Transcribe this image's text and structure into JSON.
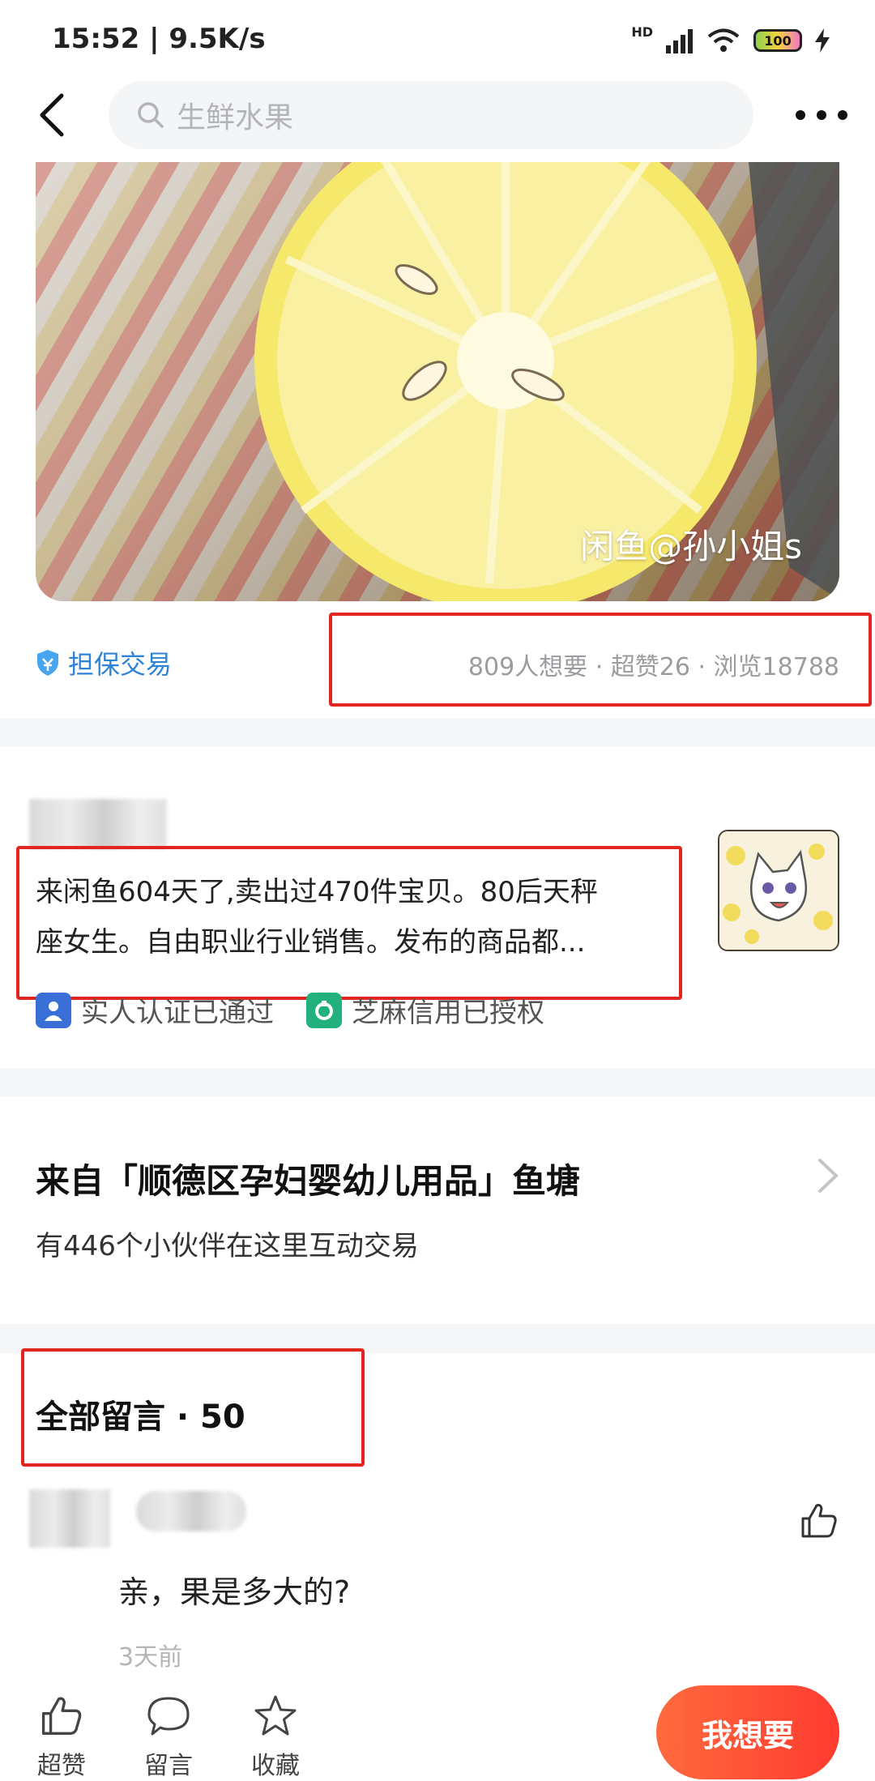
{
  "status_bar": {
    "time": "15:52 | 9.5K/s",
    "network": "HD",
    "battery": "100"
  },
  "nav": {
    "search_placeholder": "生鲜水果"
  },
  "photo": {
    "watermark": "闲鱼@孙小姐s"
  },
  "meta": {
    "guarantee_label": "担保交易",
    "stats": "809人想要 · 超赞26 · 浏览18788"
  },
  "seller": {
    "bio_line1": "来闲鱼604天了,卖出过470件宝贝。80后天秤",
    "bio_line2": "座女生。自由职业行业销售。发布的商品都...",
    "badges": [
      {
        "label": "实人认证已通过",
        "icon": "verified-person-icon",
        "color": "#3a6fd8"
      },
      {
        "label": "芝麻信用已授权",
        "icon": "sesame-credit-icon",
        "color": "#22b07d"
      }
    ]
  },
  "pond": {
    "title": "来自「顺德区孕妇婴幼儿用品」鱼塘",
    "subtitle": "有446个小伙伴在这里互动交易"
  },
  "comments": {
    "title": "全部留言 · 50",
    "items": [
      {
        "text": "亲，果是多大的?",
        "time": "3天前"
      }
    ]
  },
  "bottom_bar": {
    "like_label": "超赞",
    "comment_label": "留言",
    "favorite_label": "收藏",
    "want_label": "我想要",
    "accent": "#ff3b30"
  }
}
